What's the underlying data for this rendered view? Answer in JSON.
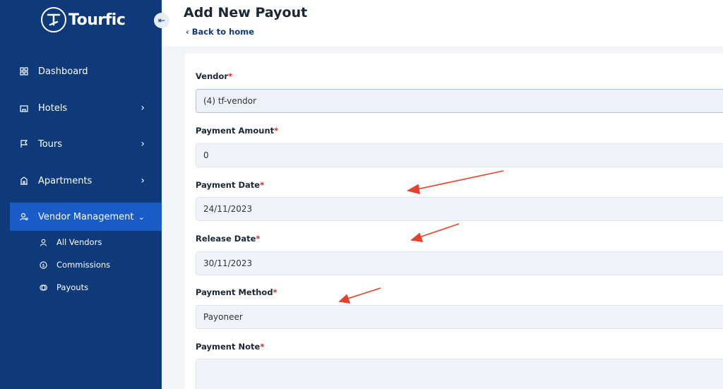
{
  "brand": {
    "name": "Tourfic"
  },
  "sidebar": {
    "items": [
      {
        "label": "Dashboard",
        "icon": "dashboard-icon"
      },
      {
        "label": "Hotels",
        "icon": "hotel-icon"
      },
      {
        "label": "Tours",
        "icon": "flag-icon"
      },
      {
        "label": "Apartments",
        "icon": "apartment-icon"
      },
      {
        "label": "Vendor Management",
        "icon": "vendor-icon"
      }
    ],
    "sub_items": [
      {
        "label": "All Vendors",
        "icon": "user-icon"
      },
      {
        "label": "Commissions",
        "icon": "dollar-icon"
      },
      {
        "label": "Payouts",
        "icon": "payout-icon"
      }
    ]
  },
  "header": {
    "title": "Add New Payout",
    "back_label": "Back to home"
  },
  "form": {
    "vendor": {
      "label": "Vendor",
      "value": "(4) tf-vendor"
    },
    "amount": {
      "label": "Payment Amount",
      "value": "0"
    },
    "date": {
      "label": "Payment Date",
      "value": "24/11/2023"
    },
    "release": {
      "label": "Release Date",
      "value": "30/11/2023"
    },
    "method": {
      "label": "Payment Method",
      "value": "Payoneer"
    },
    "note": {
      "label": "Payment Note",
      "value": ""
    },
    "required_mark": "*"
  },
  "colors": {
    "sidebar": "#0e3a7a",
    "active": "#1a5cc7",
    "required": "#e02424",
    "annotation": "#e8402a"
  }
}
